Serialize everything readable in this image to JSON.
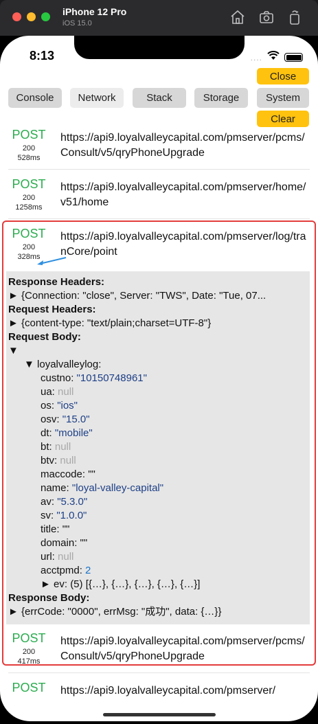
{
  "simulator": {
    "device": "iPhone 12 Pro",
    "os": "iOS 15.0",
    "icons": [
      "home-icon",
      "camera-icon",
      "rotate-icon"
    ]
  },
  "status_bar": {
    "time": "8:13",
    "signal_dots": "...."
  },
  "toolbar": {
    "tabs": [
      "Console",
      "Network",
      "Stack",
      "Storage",
      "System"
    ],
    "active_tab": "Network",
    "close_label": "Close",
    "clear_label": "Clear"
  },
  "requests": [
    {
      "method": "POST",
      "status": "200",
      "duration": "528ms",
      "url": "https://api9.loyalvalleycapital.com/pmserver/pcms/Consult/v5/qryPhoneUpgrade"
    },
    {
      "method": "POST",
      "status": "200",
      "duration": "1258ms",
      "url": "https://api9.loyalvalleycapital.com/pmserver/home/v51/home"
    },
    {
      "method": "POST",
      "status": "200",
      "duration": "328ms",
      "url": "https://api9.loyalvalleycapital.com/pmserver/log/tranCore/point"
    },
    {
      "method": "POST",
      "status": "200",
      "duration": "417ms",
      "url": "https://api9.loyalvalleycapital.com/pmserver/pcms/Consult/v5/qryPhoneUpgrade"
    },
    {
      "method": "POST",
      "url": "https://api9.loyalvalleycapital.com/pmserver/"
    }
  ],
  "detail": {
    "response_headers_label": "Response Headers:",
    "response_headers_value": "► {Connection: \"close\", Server: \"TWS\", Date: \"Tue, 07...",
    "request_headers_label": "Request Headers:",
    "request_headers_value": "► {content-type: \"text/plain;charset=UTF-8\"}",
    "request_body_label": "Request Body:",
    "request_body_toggle": "▼",
    "log_node": "▼ loyalvalleylog:",
    "fields": [
      {
        "key": "custno:",
        "value": "\"10150748961\"",
        "kind": "str"
      },
      {
        "key": "ua:",
        "value": "null",
        "kind": "nul"
      },
      {
        "key": "os:",
        "value": "\"ios\"",
        "kind": "str"
      },
      {
        "key": "osv:",
        "value": "\"15.0\"",
        "kind": "str"
      },
      {
        "key": "dt:",
        "value": "\"mobile\"",
        "kind": "str"
      },
      {
        "key": "bt:",
        "value": "null",
        "kind": "nul"
      },
      {
        "key": "btv:",
        "value": "null",
        "kind": "nul"
      },
      {
        "key": "maccode:",
        "value": "\"\"",
        "kind": "key"
      },
      {
        "key": "name:",
        "value": "\"loyal-valley-capital\"",
        "kind": "str"
      },
      {
        "key": "av:",
        "value": "\"5.3.0\"",
        "kind": "str"
      },
      {
        "key": "sv:",
        "value": "\"1.0.0\"",
        "kind": "str"
      },
      {
        "key": "title:",
        "value": "\"\"",
        "kind": "key"
      },
      {
        "key": "domain:",
        "value": "\"\"",
        "kind": "key"
      },
      {
        "key": "url:",
        "value": "null",
        "kind": "nul"
      },
      {
        "key": "acctpmd:",
        "value": "2",
        "kind": "num"
      }
    ],
    "ev_line": "► ev: (5) [{…}, {…}, {…}, {…}, {…}]",
    "response_body_label": "Response Body:",
    "response_body_value": "► {errCode: \"0000\", errMsg: \"成功\", data: {…}}"
  },
  "colors": {
    "post": "#2bac4f",
    "highlight": "#e33b3b",
    "button_yellow": "#ffc20e",
    "string_value": "#1d3f86",
    "null_value": "#a8a8a8",
    "number_value": "#1a73c7"
  }
}
